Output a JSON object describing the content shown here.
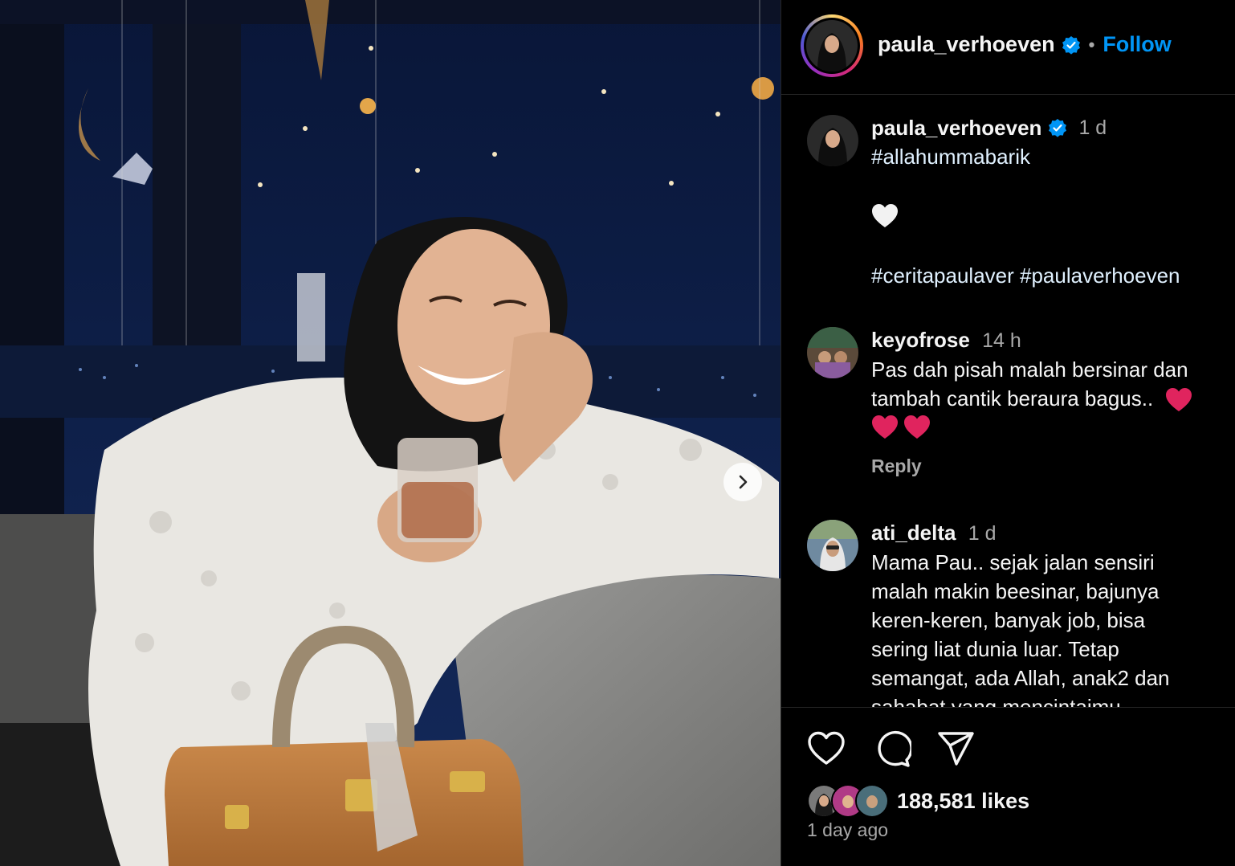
{
  "post": {
    "username": "paula_verhoeven",
    "follow_label": "Follow",
    "separator": "•",
    "caption": {
      "time": "1 d",
      "line1": "#allahummabarik",
      "line2_emoji": "white-heart",
      "line3": "#ceritapaulaver #paulaverhoeven"
    }
  },
  "comments": [
    {
      "username": "keyofrose",
      "time": "14 h",
      "text_line1": "Pas dah pisah malah bersinar dan",
      "text_line2": "tambah cantik beraura bagus..",
      "emojis": [
        "red-heart",
        "red-heart",
        "red-heart"
      ],
      "reply_label": "Reply"
    },
    {
      "username": "ati_delta",
      "time": "1 d",
      "lines": [
        "Mama Pau.. sejak jalan sensiri",
        "malah makin beesinar, bajunya",
        "keren-keren, banyak job, bisa",
        "sering liat dunia luar. Tetap",
        "semangat, ada Allah, anak2 dan",
        "sahabat yang mencintaimu"
      ]
    }
  ],
  "footer": {
    "likes": "188,581 likes",
    "posted": "1 day ago"
  },
  "icons": [
    "verified-badge-icon",
    "chevron-right-icon",
    "heart-icon",
    "comment-icon",
    "share-icon"
  ],
  "colors": {
    "accent": "#0095f6",
    "secondary_text": "#a8a8a8",
    "divider": "#262626"
  }
}
